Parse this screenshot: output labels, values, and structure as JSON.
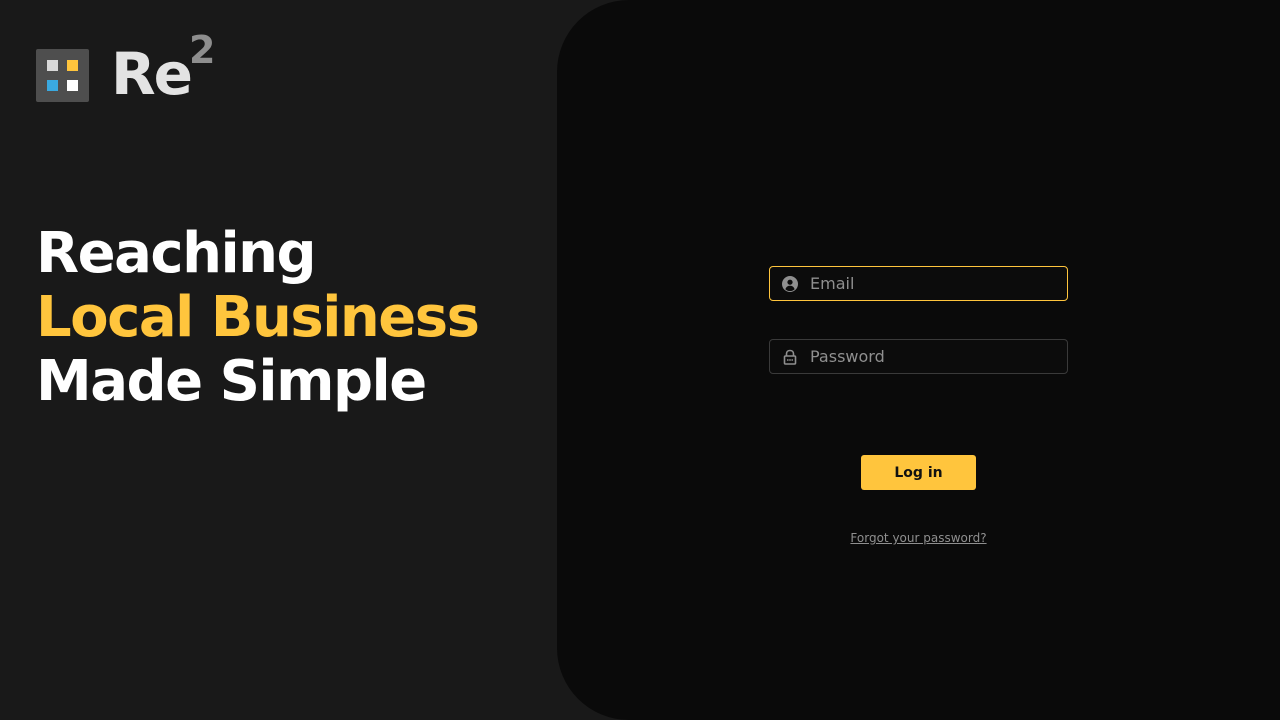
{
  "brand": {
    "wordmark": "Re",
    "superscript": "2",
    "colors": {
      "mark_bg": "#4e4e4e",
      "square_tl": "#d9d9d9",
      "square_tr": "#ffc53d",
      "square_bl": "#3aa9e0",
      "square_br": "#ffffff"
    }
  },
  "headline": {
    "line1": "Reaching",
    "line2": "Local Business",
    "line3": "Made Simple"
  },
  "login_form": {
    "email_placeholder": "Email",
    "email_value": "",
    "password_placeholder": "Password",
    "password_value": "",
    "submit_label": "Log in",
    "forgot_link": "Forgot your password?"
  },
  "icons": {
    "email": "user-circle-icon",
    "password": "lock-icon"
  },
  "theme": {
    "accent": "#ffc53d",
    "background": "#191919",
    "panel": "#0a0a0a"
  }
}
